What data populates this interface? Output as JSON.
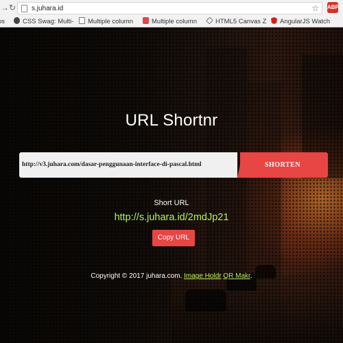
{
  "browser": {
    "url": "s.juhara.id",
    "bookmarks": [
      {
        "label": "ps",
        "icon": "apps-icon"
      },
      {
        "label": "CSS Swag: Multi-",
        "icon": "css-icon"
      },
      {
        "label": "Multiple column",
        "icon": "page-icon"
      },
      {
        "label": "Multiple column",
        "icon": "red-bookmark-icon"
      },
      {
        "label": "HTML5 Canvas Z",
        "icon": "hex-icon"
      },
      {
        "label": "AngularJS Watch",
        "icon": "angular-icon"
      }
    ],
    "extension_label": "ABP"
  },
  "app": {
    "title": "URL Shortnr",
    "input_value": "http://v3.juhara.com/dasar-penggunaan-interface-di-pascal.html",
    "shorten_label": "SHORTEN",
    "result_label": "Short URL",
    "short_url": "http://s.juhara.id/2mdJp21",
    "copy_label": "Copy URL",
    "footer_text": "Copyright © 2017 juhara.com.",
    "footer_links": [
      "Image Holdr",
      "QR Makr"
    ],
    "footer_end": "."
  },
  "colors": {
    "accent": "#e84545",
    "link": "#b8f05a"
  }
}
